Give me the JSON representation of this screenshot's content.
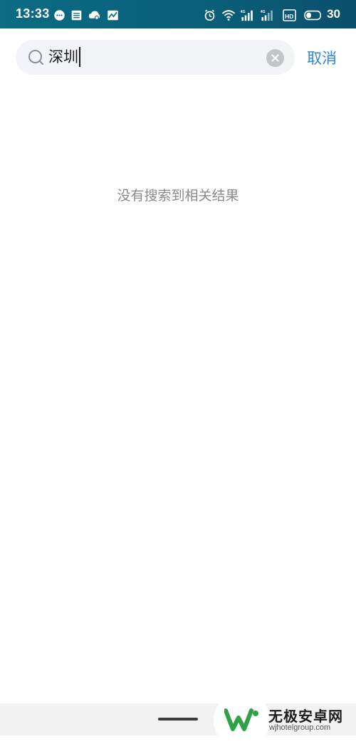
{
  "status_bar": {
    "time": "13:33",
    "network_left": "4G",
    "network_right": "4G",
    "hd_label": "HD",
    "battery": "30",
    "icons": [
      "chat-icon",
      "list-icon",
      "cloud-icon",
      "chart-icon",
      "alarm-icon",
      "wifi-icon",
      "signal-icon",
      "signal-icon",
      "hd-icon",
      "battery-icon"
    ]
  },
  "search": {
    "query": "深圳",
    "cancel_label": "取消"
  },
  "results": {
    "empty_message": "没有搜索到相关结果"
  },
  "watermark": {
    "title": "无极安卓网",
    "url": "wjhotelgroup.com"
  },
  "colors": {
    "status_bar": "#0b6c84",
    "accent": "#2b86d9",
    "search_bg": "#f3f4f7",
    "empty_text": "#8a8a8a",
    "logo_green": "#2fa146"
  }
}
